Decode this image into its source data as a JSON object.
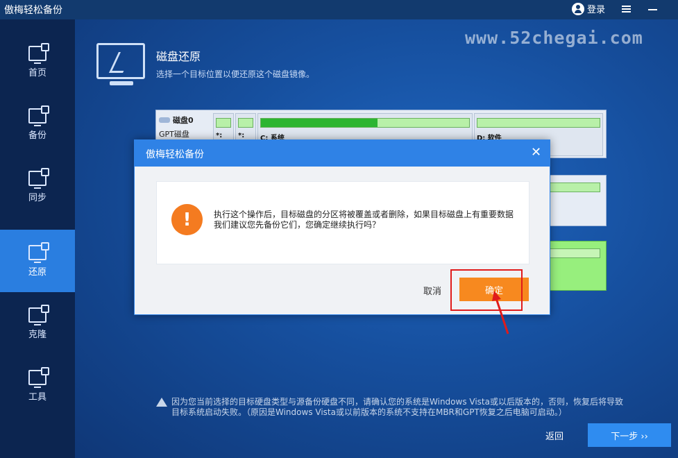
{
  "titlebar": {
    "app_title": "傲梅轻松备份",
    "login_label": "登录"
  },
  "sidebar": {
    "items": [
      {
        "label": "首页",
        "icon": "home-icon"
      },
      {
        "label": "备份",
        "icon": "backup-icon"
      },
      {
        "label": "同步",
        "icon": "sync-icon"
      },
      {
        "label": "还原",
        "icon": "restore-icon",
        "active": true
      },
      {
        "label": "克隆",
        "icon": "clone-icon"
      },
      {
        "label": "工具",
        "icon": "tools-icon"
      }
    ]
  },
  "watermark": "www.52chegai.com",
  "page": {
    "title": "磁盘还原",
    "subtitle": "选择一个目标位置以便还原这个磁盘镜像。"
  },
  "disk": {
    "name": "磁盘0",
    "type": "GPT磁盘",
    "partitions": [
      {
        "label": "*:"
      },
      {
        "label": "*:"
      },
      {
        "label": "C: 系统",
        "used_fraction": 0.56
      },
      {
        "label": "D: 软件"
      }
    ]
  },
  "footer": {
    "warning": "因为您当前选择的目标硬盘类型与源备份硬盘不同，请确认您的系统是Windows Vista或以后版本的，否则，恢复后将导致目标系统启动失败。（原因是Windows Vista或以前版本的系统不支持在MBR和GPT恢复之后电脑可启动。）",
    "back_label": "返回",
    "next_label": "下一步 ››"
  },
  "dialog": {
    "title": "傲梅轻松备份",
    "message_line1": "执行这个操作后，目标磁盘的分区将被覆盖或者删除，如果目标磁盘上有重要数据",
    "message_line2": "我们建议您先备份它们，您确定继续执行吗？",
    "cancel_label": "取消",
    "ok_label": "确定",
    "alert_glyph": "!"
  },
  "colors": {
    "accent": "#2f82e6",
    "ok_button": "#f7891f",
    "highlight": "#e01b1b",
    "sidebar_active": "#2a7ee0"
  }
}
